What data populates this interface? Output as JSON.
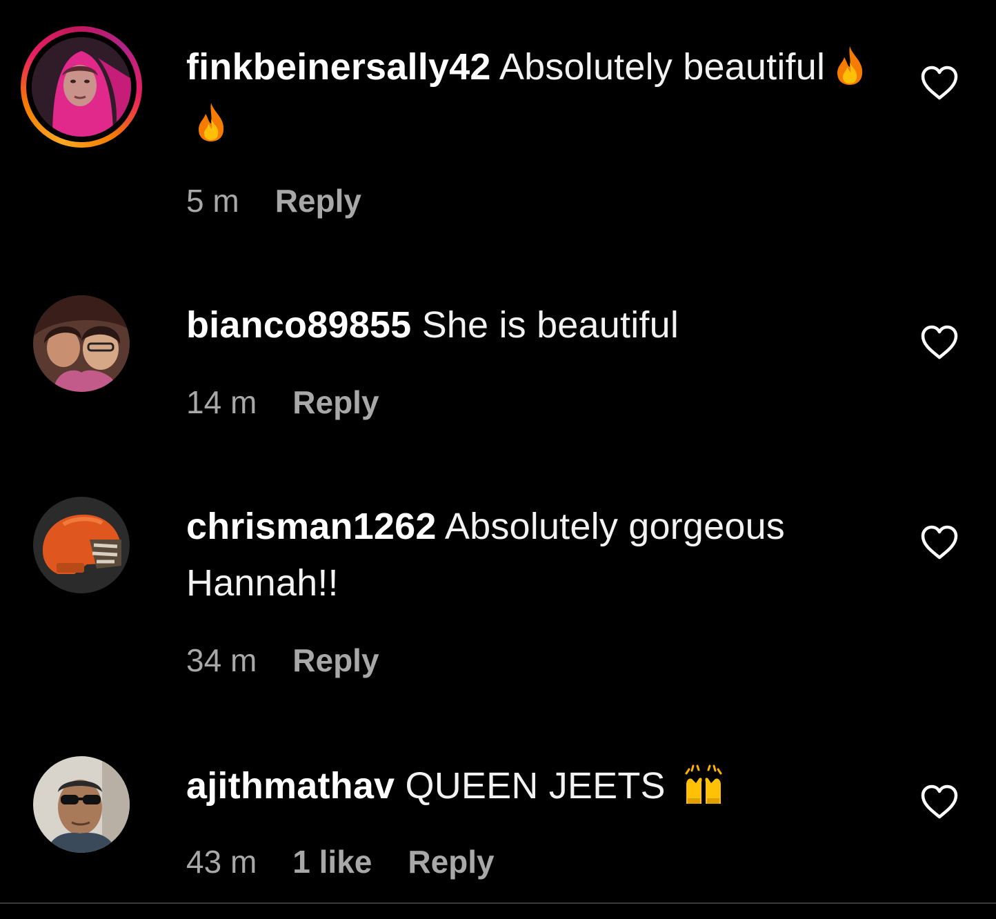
{
  "comments": [
    {
      "username": "finkbeinersally42",
      "text": "Absolutely beautiful",
      "emoji": [
        "fire-emoji",
        "fire-emoji"
      ],
      "time": "5 m",
      "likes": "",
      "reply_label": "Reply",
      "avatar": "user-avatar-pink-hood",
      "has_story_ring": true
    },
    {
      "username": "bianco89855",
      "text": "She is beautiful",
      "emoji": [],
      "time": "14 m",
      "likes": "",
      "reply_label": "Reply",
      "avatar": "user-avatar-two-people",
      "has_story_ring": false
    },
    {
      "username": "chrisman1262",
      "text": "Absolutely gorgeous Hannah!!",
      "emoji": [],
      "time": "34 m",
      "likes": "",
      "reply_label": "Reply",
      "avatar": "user-avatar-orange-helmet",
      "has_story_ring": false
    },
    {
      "username": "ajithmathav",
      "text": "QUEEN JEETS",
      "emoji": [
        "raising-hands-emoji"
      ],
      "time": "43 m",
      "likes": "1 like",
      "reply_label": "Reply",
      "avatar": "user-avatar-man-sunglasses",
      "has_story_ring": false
    }
  ],
  "colors": {
    "background": "#000000",
    "primary_text": "#f5f5f5",
    "secondary_text": "#a8a8a8",
    "story_ring": [
      "#f9a825",
      "#e91e63",
      "#b0238a"
    ]
  },
  "icons": {
    "like": "heart-outline-icon"
  }
}
